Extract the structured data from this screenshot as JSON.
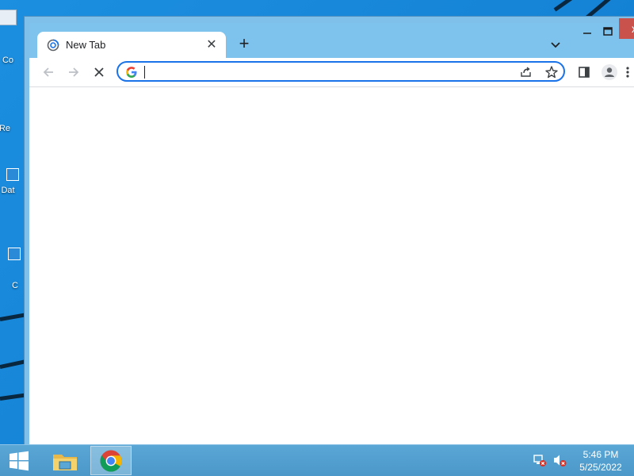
{
  "desktop": {
    "icons": [
      {
        "label": "Co"
      },
      {
        "label": "Re"
      },
      {
        "label": "Dat"
      },
      {
        "label": "C"
      }
    ]
  },
  "browser": {
    "tab": {
      "title": "New Tab"
    },
    "omnibox": {
      "value": "",
      "placeholder": ""
    },
    "window_close_label": "x"
  },
  "taskbar": {
    "clock": {
      "time": "5:46 PM",
      "date": "5/25/2022"
    }
  },
  "colors": {
    "desktop": "#1583d6",
    "browser_frame": "#7ec3ee",
    "omnibox_border": "#1a73e8",
    "close_button": "#c9524d",
    "taskbar": "#4b98c9"
  },
  "icons": [
    "back-arrow-icon",
    "forward-arrow-icon",
    "stop-loading-icon",
    "google-g-icon",
    "share-icon",
    "star-icon",
    "side-panel-icon",
    "profile-icon",
    "menu-dots-icon",
    "windows-logo-icon",
    "file-explorer-icon",
    "chrome-icon",
    "network-warning-icon",
    "volume-muted-icon"
  ]
}
